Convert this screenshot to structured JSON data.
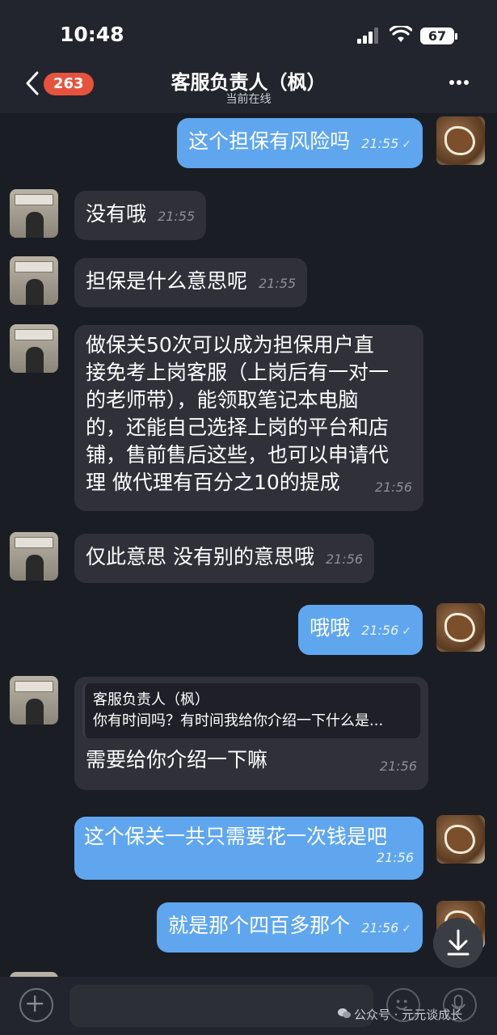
{
  "status_bar": {
    "time": "10:48",
    "battery": "67"
  },
  "header": {
    "badge": "263",
    "title": "客服负责人（枫）",
    "subtitle": "当前在线"
  },
  "messages": [
    {
      "dir": "out",
      "text": "这个担保有风险吗",
      "time": "21:55"
    },
    {
      "dir": "in",
      "text": "没有哦",
      "time": "21:55"
    },
    {
      "dir": "in",
      "text": "担保是什么意思呢",
      "time": "21:55"
    },
    {
      "dir": "in",
      "lines": [
        "做保关50次可以成为担保用户直",
        "接免考上岗客服（上岗后有一对一",
        "的老师带），能领取笔记本电脑",
        "的，还能自己选择上岗的平台和店",
        "铺，售前售后这些，也可以申请代",
        "理 做代理有百分之10的提成"
      ],
      "time": "21:56"
    },
    {
      "dir": "in",
      "text": "仅此意思 没有别的意思哦",
      "time": "21:56"
    },
    {
      "dir": "out",
      "text": "哦哦",
      "time": "21:56"
    },
    {
      "dir": "in",
      "quote_name": "客服负责人（枫）",
      "quote_text": "你有时间吗？有时间我给你介绍一下什么是...",
      "text": "需要给你介绍一下嘛",
      "time": "21:56"
    },
    {
      "dir": "out",
      "text": "这个保关一共只需要花一次钱是吧",
      "time": "21:56"
    },
    {
      "dir": "out",
      "text": "就是那个四百多那个",
      "time": "21:56"
    }
  ],
  "input_bar": {
    "placeholder": "",
    "watermark": "公众号 · 元元谈成长"
  }
}
